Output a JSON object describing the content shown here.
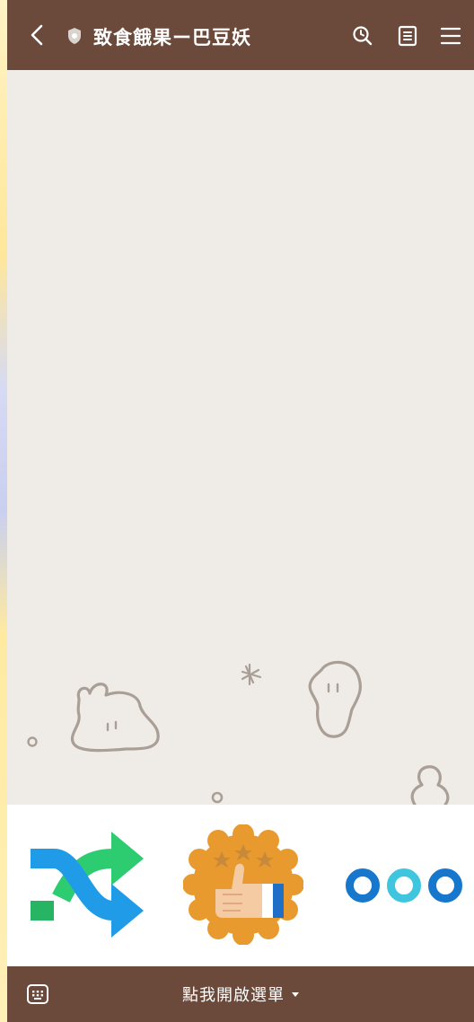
{
  "header": {
    "title": "致食餓果ー巴豆妖",
    "back_icon": "chevron-left-icon",
    "badge_icon": "shield-icon",
    "actions": [
      "search-icon",
      "notes-icon",
      "hamburger-menu-icon"
    ]
  },
  "rich_menu": {
    "items": [
      {
        "icon": "shuffle-arrows-icon"
      },
      {
        "icon": "thumbs-up-badge-icon"
      },
      {
        "icon": "three-circles-icon"
      }
    ]
  },
  "footer": {
    "keyboard_icon": "keyboard-icon",
    "open_menu_label": "點我開啟選單",
    "caret_icon": "caret-down-icon"
  },
  "colors": {
    "bar_brown": "#6b4a3b",
    "chat_bg": "#efebe6",
    "doodle_stroke": "#a99f96",
    "shuffle_blue": "#1f9be8",
    "shuffle_green": "#2ecc71",
    "badge_orange": "#e89a2e",
    "circle_blue": "#1677cc",
    "circle_cyan": "#3fc6de"
  }
}
